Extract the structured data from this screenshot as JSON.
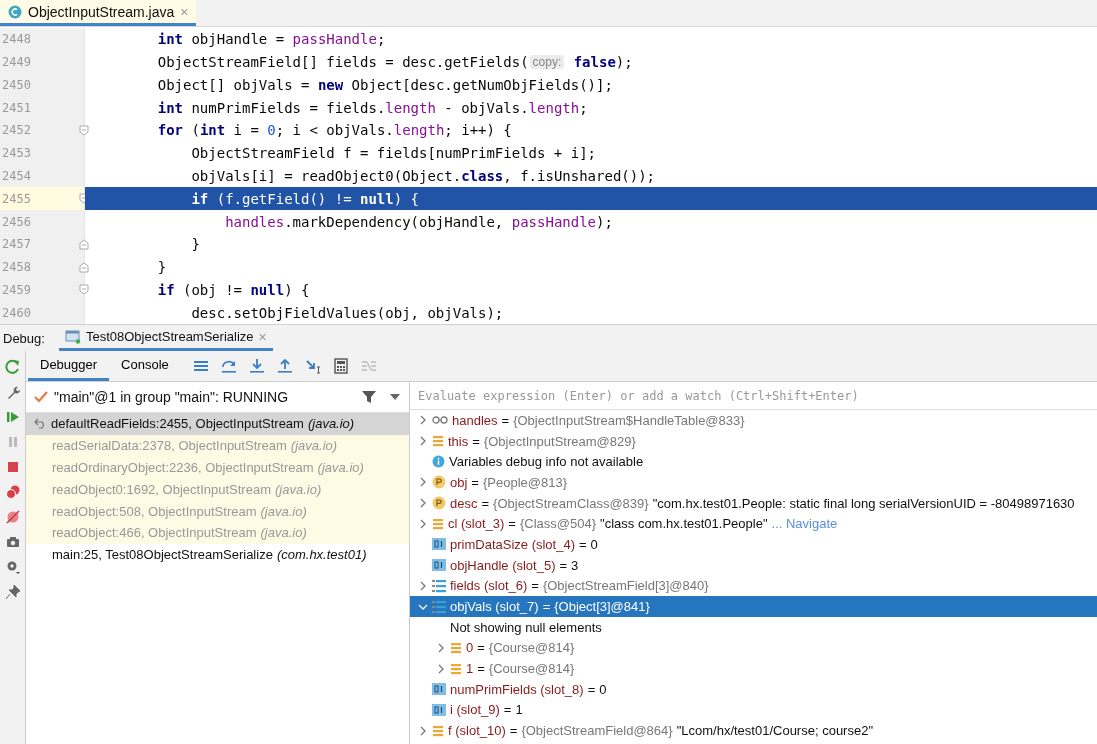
{
  "editor_tab": {
    "title": "ObjectInputStream.java",
    "close": "×"
  },
  "code": [
    {
      "number": "2448",
      "kind": "plain",
      "current": false,
      "segments": [
        {
          "kind": "keyword",
          "text": "    int"
        },
        {
          "kind": "plain",
          "text": " objHandle = "
        },
        {
          "kind": "field",
          "text": "passHandle"
        },
        {
          "kind": "plain",
          "text": ";"
        }
      ]
    },
    {
      "number": "2449",
      "kind": "plain",
      "current": false,
      "segments": [
        {
          "kind": "plain",
          "text": "    ObjectStreamField[] fields = desc.getFields("
        },
        {
          "kind": "hint",
          "text": "copy:"
        },
        {
          "kind": "keyword",
          "text": " false"
        },
        {
          "kind": "plain",
          "text": ");"
        }
      ]
    },
    {
      "number": "2450",
      "kind": "plain",
      "current": false,
      "segments": [
        {
          "kind": "plain",
          "text": "    Object[] objVals = "
        },
        {
          "kind": "keyword",
          "text": "new"
        },
        {
          "kind": "plain",
          "text": " Object[desc.getNumObjFields()];"
        }
      ]
    },
    {
      "number": "2451",
      "kind": "plain",
      "current": false,
      "segments": [
        {
          "kind": "keyword",
          "text": "    int"
        },
        {
          "kind": "plain",
          "text": " numPrimFields = fields."
        },
        {
          "kind": "field",
          "text": "length"
        },
        {
          "kind": "plain",
          "text": " - objVals."
        },
        {
          "kind": "field",
          "text": "length"
        },
        {
          "kind": "plain",
          "text": ";"
        }
      ]
    },
    {
      "number": "2452",
      "kind": "fold-start",
      "current": false,
      "segments": [
        {
          "kind": "keyword",
          "text": "    for"
        },
        {
          "kind": "plain",
          "text": " ("
        },
        {
          "kind": "keyword",
          "text": "int"
        },
        {
          "kind": "plain",
          "text": " i = "
        },
        {
          "kind": "number",
          "text": "0"
        },
        {
          "kind": "plain",
          "text": "; i < objVals."
        },
        {
          "kind": "field",
          "text": "length"
        },
        {
          "kind": "plain",
          "text": "; i++) {"
        }
      ]
    },
    {
      "number": "2453",
      "kind": "plain",
      "current": false,
      "segments": [
        {
          "kind": "plain",
          "text": "        ObjectStreamField f = fields[numPrimFields + i];"
        }
      ]
    },
    {
      "number": "2454",
      "kind": "plain",
      "current": false,
      "segments": [
        {
          "kind": "plain",
          "text": "        objVals[i] = readObject0(Object."
        },
        {
          "kind": "keyword",
          "text": "class"
        },
        {
          "kind": "plain",
          "text": ", f.isUnshared());"
        }
      ]
    },
    {
      "number": "2455",
      "kind": "fold-start",
      "current": true,
      "segments": [
        {
          "kind": "keyword",
          "text": "        if"
        },
        {
          "kind": "plain",
          "text": " (f.getField() != "
        },
        {
          "kind": "keyword",
          "text": "null"
        },
        {
          "kind": "plain",
          "text": ") {"
        }
      ]
    },
    {
      "number": "2456",
      "kind": "plain",
      "current": false,
      "segments": [
        {
          "kind": "field",
          "text": "            handles"
        },
        {
          "kind": "plain",
          "text": ".markDependency(objHandle, "
        },
        {
          "kind": "field",
          "text": "passHandle"
        },
        {
          "kind": "plain",
          "text": ");"
        }
      ]
    },
    {
      "number": "2457",
      "kind": "fold-end",
      "current": false,
      "segments": [
        {
          "kind": "plain",
          "text": "        }"
        }
      ]
    },
    {
      "number": "2458",
      "kind": "fold-end",
      "current": false,
      "segments": [
        {
          "kind": "plain",
          "text": "    }"
        }
      ]
    },
    {
      "number": "2459",
      "kind": "fold-start",
      "current": false,
      "segments": [
        {
          "kind": "keyword",
          "text": "    if"
        },
        {
          "kind": "plain",
          "text": " (obj != "
        },
        {
          "kind": "keyword",
          "text": "null"
        },
        {
          "kind": "plain",
          "text": ") {"
        }
      ]
    },
    {
      "number": "2460",
      "kind": "plain",
      "current": false,
      "segments": [
        {
          "kind": "plain",
          "text": "        desc.setObjFieldValues(obj, objVals);"
        }
      ]
    }
  ],
  "debug": {
    "label": "Debug:",
    "session": {
      "title": "Test08ObjectStreamSerialize",
      "close": "×"
    },
    "tabs": [
      {
        "label": "Debugger",
        "selected": true
      },
      {
        "label": "Console",
        "selected": false
      }
    ],
    "thread": "\"main\"@1 in group \"main\": RUNNING",
    "frames": [
      {
        "method": "defaultReadFields:2455, ObjectInputStream",
        "package": "(java.io)",
        "selected": true,
        "library": false
      },
      {
        "method": "readSerialData:2378, ObjectInputStream",
        "package": "(java.io)",
        "selected": false,
        "library": true
      },
      {
        "method": "readOrdinaryObject:2236, ObjectInputStream",
        "package": "(java.io)",
        "selected": false,
        "library": true
      },
      {
        "method": "readObject0:1692, ObjectInputStream",
        "package": "(java.io)",
        "selected": false,
        "library": true
      },
      {
        "method": "readObject:508, ObjectInputStream",
        "package": "(java.io)",
        "selected": false,
        "library": true
      },
      {
        "method": "readObject:466, ObjectInputStream",
        "package": "(java.io)",
        "selected": false,
        "library": true
      },
      {
        "method": "main:25, Test08ObjectStreamSerialize",
        "package": "(com.hx.test01)",
        "selected": false,
        "library": false
      }
    ],
    "evaluate_placeholder": "Evaluate expression (Enter) or add a watch (Ctrl+Shift+Enter)",
    "variables": [
      {
        "kind": "watch",
        "name": "handles",
        "sign": "=",
        "value": "{ObjectInputStream$HandleTable@833}",
        "expanded": false,
        "selected": false
      },
      {
        "kind": "object",
        "name": "this",
        "sign": "=",
        "value": "{ObjectInputStream@829}",
        "expanded": false,
        "selected": false
      },
      {
        "kind": "info",
        "message": "Variables debug info not available",
        "selected": false
      },
      {
        "kind": "param",
        "name": "obj",
        "sign": "=",
        "value": "{People@813}",
        "expanded": false,
        "selected": false
      },
      {
        "kind": "param",
        "name": "desc",
        "sign": "=",
        "value": "{ObjectStreamClass@839}",
        "extra": "\"com.hx.test01.People: static final long serialVersionUID = -80498971630",
        "expanded": false,
        "selected": false
      },
      {
        "kind": "object",
        "name": "cl (slot_3)",
        "sign": "=",
        "value": "{Class@504}",
        "extra": "\"class com.hx.test01.People\"",
        "link": "... Navigate",
        "expanded": false,
        "selected": false
      },
      {
        "kind": "primitive",
        "name": "primDataSize (slot_4)",
        "sign": "=",
        "value": "0",
        "selected": false
      },
      {
        "kind": "primitive",
        "name": "objHandle (slot_5)",
        "sign": "=",
        "value": "3",
        "selected": false
      },
      {
        "kind": "array",
        "name": "fields (slot_6)",
        "sign": "=",
        "value": "{ObjectStreamField[3]@840}",
        "expanded": false,
        "selected": false
      },
      {
        "kind": "array",
        "name": "objVals (slot_7)",
        "sign": "=",
        "value": "{Object[3]@841}",
        "expanded": true,
        "selected": true,
        "children": [
          {
            "kind": "note",
            "message": "Not showing null elements",
            "selected": false
          },
          {
            "kind": "object",
            "name": "0",
            "sign": "=",
            "value": "{Course@814}",
            "expanded": false,
            "selected": false
          },
          {
            "kind": "object",
            "name": "1",
            "sign": "=",
            "value": "{Course@814}",
            "expanded": false,
            "selected": false
          }
        ]
      },
      {
        "kind": "primitive",
        "name": "numPrimFields (slot_8)",
        "sign": "=",
        "value": "0",
        "selected": false
      },
      {
        "kind": "primitive",
        "name": "i (slot_9)",
        "sign": "=",
        "value": "1",
        "selected": false
      },
      {
        "kind": "object",
        "name": "f (slot_10)",
        "sign": "=",
        "value": "{ObjectStreamField@864}",
        "extra": "\"Lcom/hx/test01/Course; course2\"",
        "expanded": false,
        "selected": false
      }
    ]
  }
}
